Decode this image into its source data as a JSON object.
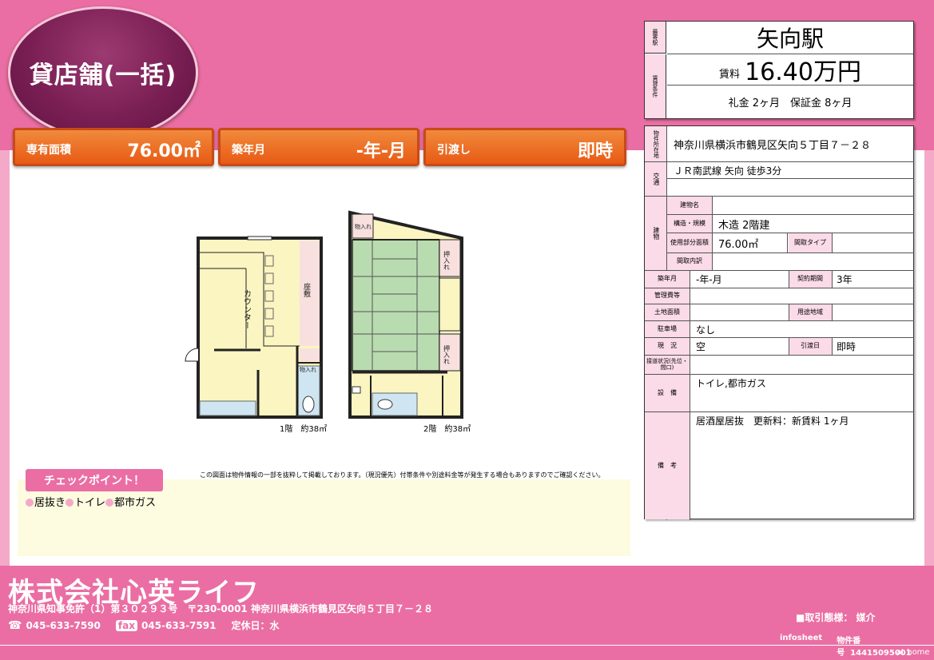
{
  "header": {
    "title": "貸店舗(一括)",
    "area_label": "専有面積",
    "area_value": "76.00㎡",
    "built_label": "築年月",
    "built_value": "-年-月",
    "handover_label": "引渡し",
    "handover_value": "即時"
  },
  "summary": {
    "station_key": "最寄駅",
    "station": "矢向駅",
    "terms_key": "賃貸条件",
    "rent_label": "賃料",
    "rent_value": "16.40万円",
    "deposit_line": "礼金 2ヶ月　保証金 8ヶ月"
  },
  "details": {
    "location_key": "物件所在地",
    "location": "神奈川県横浜市鶴見区矢向５丁目７－２８",
    "transport_key": "交通",
    "transport": "ＪＲ南武線 矢向 徒歩3分",
    "building_key": "建物",
    "building_name_key": "建物名",
    "building_name": "",
    "structure_key": "構造・規模",
    "structure": "木造 2階建",
    "usable_area_key": "使用部分面積",
    "usable_area": "76.00㎡",
    "layout_type_key": "間取タイプ",
    "layout_type": "",
    "layout_detail_key": "間取内訳",
    "layout_detail": "",
    "built_key": "築年月",
    "built": "-年-月",
    "contract_key": "契約期間",
    "contract": "3年",
    "management_key": "管理費等",
    "management": "",
    "land_area_key": "土地面積",
    "land_area": "",
    "zoning_key": "用途地域",
    "zoning": "",
    "parking_key": "駐車場",
    "parking": "なし",
    "status_key": "現　況",
    "status": "空",
    "handover_key": "引渡日",
    "handover": "即時",
    "road_key": "接道状況(先位・間口)",
    "road": "",
    "facilities_key": "設　備",
    "facilities": "トイレ,都市ガス",
    "remarks_key": "備　考",
    "remarks": "居酒屋居抜　更新料：新賃料 1ヶ月"
  },
  "floorplan": {
    "floor1_caption": "1階　約38㎡",
    "floor2_caption": "2階　約38㎡",
    "counter": "カウンター",
    "zashiki": "座敷",
    "storage1": "物入れ",
    "storage2": "物入れ",
    "closet1": "押入れ",
    "closet2": "押入れ",
    "disclaimer": "この図面は物件情報の一部を抜粋して掲載しております。（現況優先）付帯条件や別途料金等が発生する場合もありますのでご確認ください。"
  },
  "checkpoint": {
    "title": "チェックポイント！",
    "items": [
      "居抜き",
      "トイレ",
      "都市ガス"
    ]
  },
  "footer": {
    "company": "株式会社心英ライフ",
    "license_address": "神奈川県知事免許（1）第３０２９３号　〒230-0001 神奈川県横浜市鶴見区矢向５丁目７－２８",
    "tel_label": "☎",
    "tel": "045-633-7590",
    "fax_label": "fax",
    "fax": "045-633-7591",
    "holiday": "定休日：水",
    "transaction": "■取引態様： 媒介",
    "infosheet": "infosheet",
    "property_no_label": "物件番号",
    "property_no": "14415095001",
    "brand": "at home"
  },
  "colors": {
    "pink": "#ea6ea3",
    "light_pink": "#f3a9c7",
    "orange": "#e85a15",
    "tatami": "#b9dbb0",
    "floor": "#fbf5c2"
  }
}
